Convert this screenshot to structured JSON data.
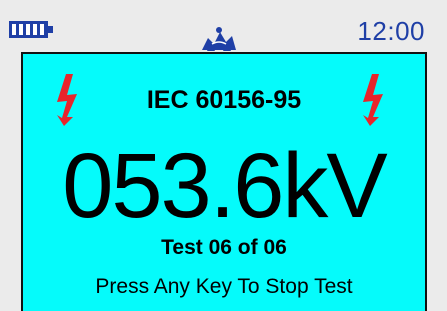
{
  "status_bar": {
    "battery_icon": "battery-full-icon",
    "mode_icon": "test-mode-icon",
    "time": "12:00",
    "time_color": "#1f3fa6"
  },
  "screen": {
    "background_color": "#05fbfb",
    "warning_icon": "high-voltage-icon",
    "warning_color": "#e8242b",
    "standard": "IEC 60156-95",
    "reading": "053.6kV",
    "test_counter": "Test 06 of 06",
    "instruction": "Press Any Key To Stop Test"
  }
}
